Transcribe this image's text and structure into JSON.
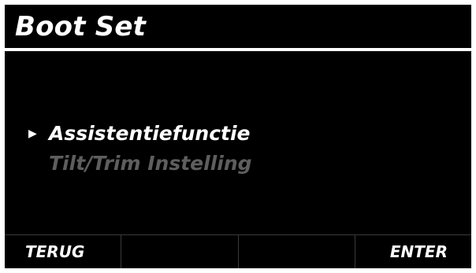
{
  "header": {
    "title": "Boot Set"
  },
  "menu": {
    "cursor_icon": "right-triangle",
    "items": [
      {
        "label": "Assistentiefunctie",
        "selected": true
      },
      {
        "label": "Tilt/Trim Instelling",
        "selected": false
      }
    ]
  },
  "softkeys": {
    "key1": "TERUG",
    "key2": "",
    "key3": "",
    "key4": "ENTER"
  },
  "colors": {
    "background": "#000000",
    "text": "#ffffff",
    "disabled_text": "#5e5e5e",
    "divider": "#3a3a3a"
  }
}
